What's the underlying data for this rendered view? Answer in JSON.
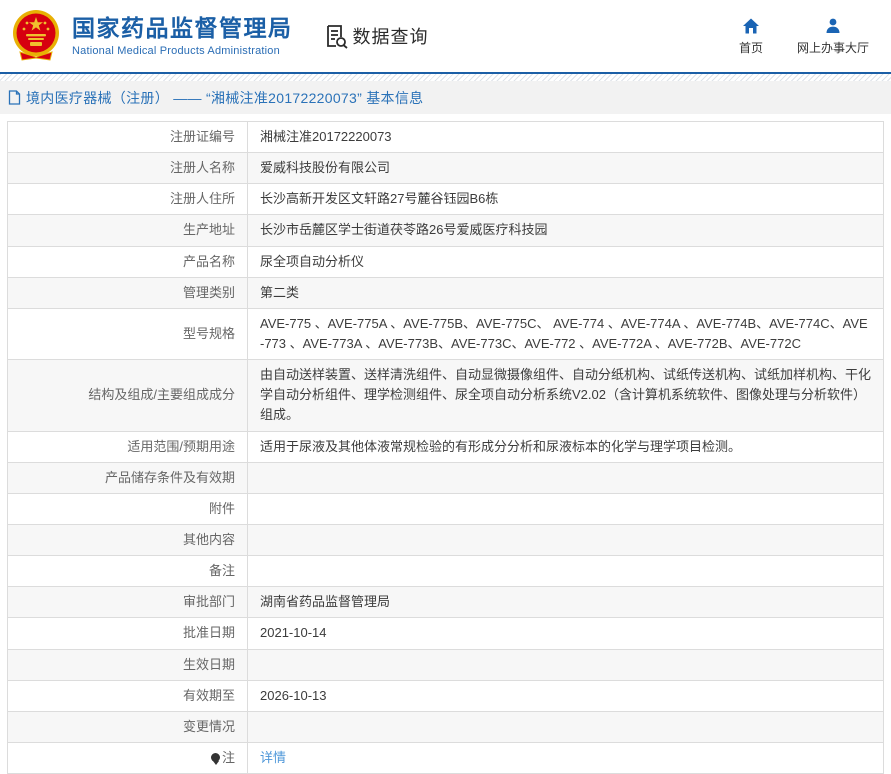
{
  "header": {
    "site_title": "国家药品监督管理局",
    "site_subtitle": "National Medical Products Administration",
    "section_title": "数据查询",
    "nav": [
      {
        "label": "首页",
        "icon": "home-icon"
      },
      {
        "label": "网上办事大厅",
        "icon": "person-icon"
      }
    ]
  },
  "breadcrumb": {
    "text": "境内医疗器械（注册） ——  “湘械注准20172220073” 基本信息"
  },
  "table": {
    "rows": [
      {
        "label": "注册证编号",
        "value": "湘械注准20172220073"
      },
      {
        "label": "注册人名称",
        "value": "爱威科技股份有限公司"
      },
      {
        "label": "注册人住所",
        "value": "长沙高新开发区文轩路27号麓谷钰园B6栋"
      },
      {
        "label": "生产地址",
        "value": "长沙市岳麓区学士街道茯苓路26号爱威医疗科技园"
      },
      {
        "label": "产品名称",
        "value": "尿全项自动分析仪"
      },
      {
        "label": "管理类别",
        "value": "第二类"
      },
      {
        "label": "型号规格",
        "value": "AVE-775 、AVE-775A 、AVE-775B、AVE-775C、 AVE-774 、AVE-774A 、AVE-774B、AVE-774C、AVE-773 、AVE-773A 、AVE-773B、AVE-773C、AVE-772 、AVE-772A 、AVE-772B、AVE-772C"
      },
      {
        "label": "结构及组成/主要组成成分",
        "value": "由自动送样装置、送样清洗组件、自动显微摄像组件、自动分纸机构、试纸传送机构、试纸加样机构、干化学自动分析组件、理学检测组件、尿全项自动分析系统V2.02（含计算机系统软件、图像处理与分析软件）组成。"
      },
      {
        "label": "适用范围/预期用途",
        "value": "适用于尿液及其他体液常规检验的有形成分分析和尿液标本的化学与理学项目检测。"
      },
      {
        "label": "产品储存条件及有效期",
        "value": ""
      },
      {
        "label": "附件",
        "value": ""
      },
      {
        "label": "其他内容",
        "value": ""
      },
      {
        "label": "备注",
        "value": ""
      },
      {
        "label": "审批部门",
        "value": "湖南省药品监督管理局"
      },
      {
        "label": "批准日期",
        "value": "2021-10-14"
      },
      {
        "label": "生效日期",
        "value": ""
      },
      {
        "label": "有效期至",
        "value": "2026-10-13"
      },
      {
        "label": "变更情况",
        "value": ""
      },
      {
        "label": "注",
        "value": "详情",
        "link": true,
        "label_icon": "note-icon"
      }
    ]
  },
  "colors": {
    "accent_blue": "#1b5fa6",
    "breadcrumb_blue": "#2a72b8",
    "link_blue": "#4e97d9",
    "emblem_red": "#d6000f",
    "emblem_gold": "#f0c02e",
    "row_stripe": "#f7f7f7",
    "border": "#dcdcdc"
  }
}
